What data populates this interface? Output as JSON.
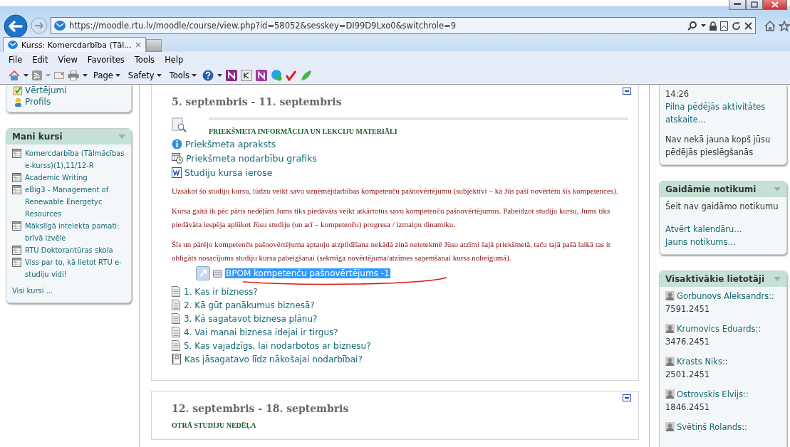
{
  "browser": {
    "url": "https://moodle.rtu.lv/moodle/course/view.php?id=58052&sesskey=DI99D9Lxo0&switchrole=9",
    "tabs": [
      {
        "title": "Kurss: Komercdarbība (Tāl...",
        "selected": true
      }
    ],
    "menu": [
      "File",
      "Edit",
      "View",
      "Favorites",
      "Tools",
      "Help"
    ],
    "commands": [
      "Page",
      "Safety",
      "Tools"
    ]
  },
  "left": {
    "nav_links": [
      "Vērtējumi",
      "Profils"
    ],
    "my_courses": {
      "title": "Mani kursi",
      "items": [
        "Komercdarbība (Tālmācības e-kurss)(1),11/12-R",
        "Academic Writing",
        "eBig3 - Management of Renewable Energetyc Resources",
        "Mākslīgā intelekta pamati: brīvā izvēle",
        "RTU Doktorantūras skola",
        "Viss par to, kā lietot RTU e-studiju vidi!"
      ],
      "footer": "Visi kursi ..."
    }
  },
  "center": {
    "sections": [
      {
        "dates": "5. septembris - 11. septembris",
        "label": "PRIEKŠMETA INFORMĀCIJA UN LEKCIJU MATERIĀLI",
        "resources": [
          {
            "kind": "info",
            "title": "Priekšmeta apraksts"
          },
          {
            "kind": "schedule",
            "title": "Priekšmeta nodarbību grafiks"
          },
          {
            "kind": "word",
            "title": "Studiju kursa ierose"
          }
        ],
        "paragraphs": [
          "Uzsākot šo studiju kursu, lūdzu veikt savu uzņēmējdarbības kompetenču pašnovērtējumu (subjektīvi – kā Jūs paši novērtētu šīs kompetences).",
          "Kursa gaitā ik pēc pāris nedēļām Jums tiks piedāvāts veikt atkārtotus savu kompetenču pašnovērtējumus. Pabeidzot studiju kursu, Jums tiks piedāvāta iespēja aplūkot Jūsu studiju (un arī – kompetenču) progresa / izmaiņu dinamiku.",
          "Šīs un pārējo kompetenču pašnovērtējuma aptauju aizpildīšana nekādā ziņā neietekmē Jūsu atzīmi šajā priekšmetā, taču tajā pašā laikā tas ir obligāts nosacījums studiju kursa pabeigšanai (sekmīga novērtējuma/atzīmes saņemšanai kursa nobeigumā)."
        ],
        "survey": {
          "title": "BPOM kompetenču pašnovērtējums -1",
          "highlighted": true
        },
        "items": [
          {
            "kind": "page",
            "title": "1. Kas ir bizness?"
          },
          {
            "kind": "page",
            "title": "2. Kā gūt panākumus biznesā?"
          },
          {
            "kind": "page",
            "title": "3. Kā sagatavot biznesa plānu?"
          },
          {
            "kind": "page",
            "title": "4. Vai manai biznesa idejai ir tirgus?"
          },
          {
            "kind": "page",
            "title": "5. Kas vajadzīgs, lai nodarbotos ar biznesu?"
          },
          {
            "kind": "journal",
            "title": "Kas jāsagatavo līdz nākošajai nodarbībai?"
          }
        ]
      },
      {
        "dates": "12. septembris - 18. septembris",
        "label": "OTRĀ STUDIJU NEDĒĻA"
      }
    ]
  },
  "right": {
    "recent": {
      "time": "14:26",
      "link": "Pilna pēdējās aktivitātes atskaite...",
      "note": "Nav nekā jauna kopš jūsu pēdējās pieslēgšanās"
    },
    "upcoming": {
      "title": "Gaidāmie notikumi",
      "note": "Šeit nav gaidāmo notikumu",
      "links": [
        "Atvērt kalendāru...",
        "Jauns notikums..."
      ]
    },
    "active_users": {
      "title": "Visaktīvākie lietotāji",
      "users": [
        {
          "name": "Gorbunovs Aleksandrs::",
          "score": "7591.2451"
        },
        {
          "name": "Krumovics Eduards::",
          "score": "3476.2451"
        },
        {
          "name": "Krasts Niks::",
          "score": "2501.2451"
        },
        {
          "name": "Ostrovskis Elvijs::",
          "score": "1846.2451"
        },
        {
          "name": "Svētiņš Rolands::"
        }
      ]
    }
  }
}
